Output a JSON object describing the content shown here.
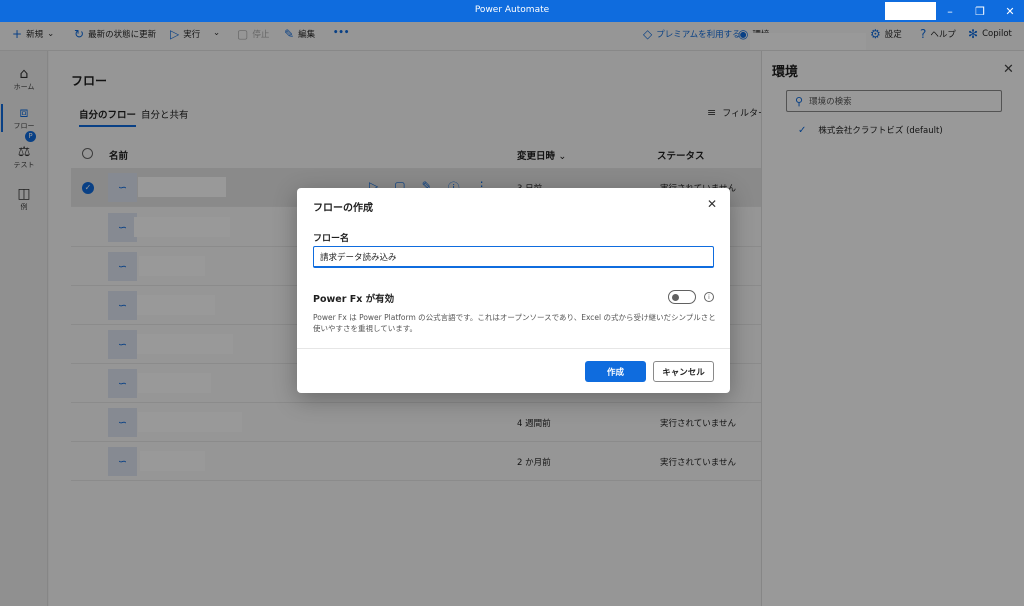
{
  "window": {
    "title": "Power Automate"
  },
  "toolbar": {
    "new_label": "新規",
    "refresh_label": "最新の状態に更新",
    "run_label": "実行",
    "stop_label": "停止",
    "edit_label": "編集",
    "more_label": "•••",
    "premium_label": "プレミアムを利用する",
    "env_label": "環境",
    "settings_label": "設定",
    "help_label": "ヘルプ",
    "copilot_label": "Copilot"
  },
  "nav": [
    {
      "label": "ホーム",
      "icon": "home-icon"
    },
    {
      "label": "フロー",
      "icon": "flow-icon"
    },
    {
      "label": "テスト",
      "icon": "test-icon",
      "badge": "P"
    },
    {
      "label": "例",
      "icon": "book-icon"
    }
  ],
  "main": {
    "title": "フロー",
    "tabs": [
      {
        "label": "自分のフロー"
      },
      {
        "label": "自分と共有"
      }
    ],
    "filter_label": "フィルター",
    "columns": {
      "name": "名前",
      "modified": "変更日時",
      "status": "ステータス"
    },
    "rows": [
      {
        "modified": "3 日前",
        "status": "実行されていません"
      },
      {
        "modified": "",
        "status": ""
      },
      {
        "modified": "",
        "status": ""
      },
      {
        "modified": "",
        "status": ""
      },
      {
        "modified": "",
        "status": ""
      },
      {
        "modified": "",
        "status": ""
      },
      {
        "modified": "4 週間前",
        "status": "実行されていません"
      },
      {
        "modified": "2 か月前",
        "status": "実行されていません"
      }
    ]
  },
  "env_panel": {
    "title": "環境",
    "search_placeholder": "環境の検索",
    "items": [
      {
        "label": "株式会社クラフトビズ (default)",
        "selected": true
      }
    ]
  },
  "dialog": {
    "title": "フローの作成",
    "name_label": "フロー名",
    "name_value": "請求データ読み込み",
    "powerfx_label": "Power Fx が有効",
    "powerfx_enabled": false,
    "description": "Power Fx は Power Platform の公式言語です。これはオープンソースであり、Excel の式から受け継いだシンプルさと使いやすさを重視しています。",
    "create_label": "作成",
    "cancel_label": "キャンセル"
  },
  "colors": {
    "accent": "#0f6cde"
  }
}
